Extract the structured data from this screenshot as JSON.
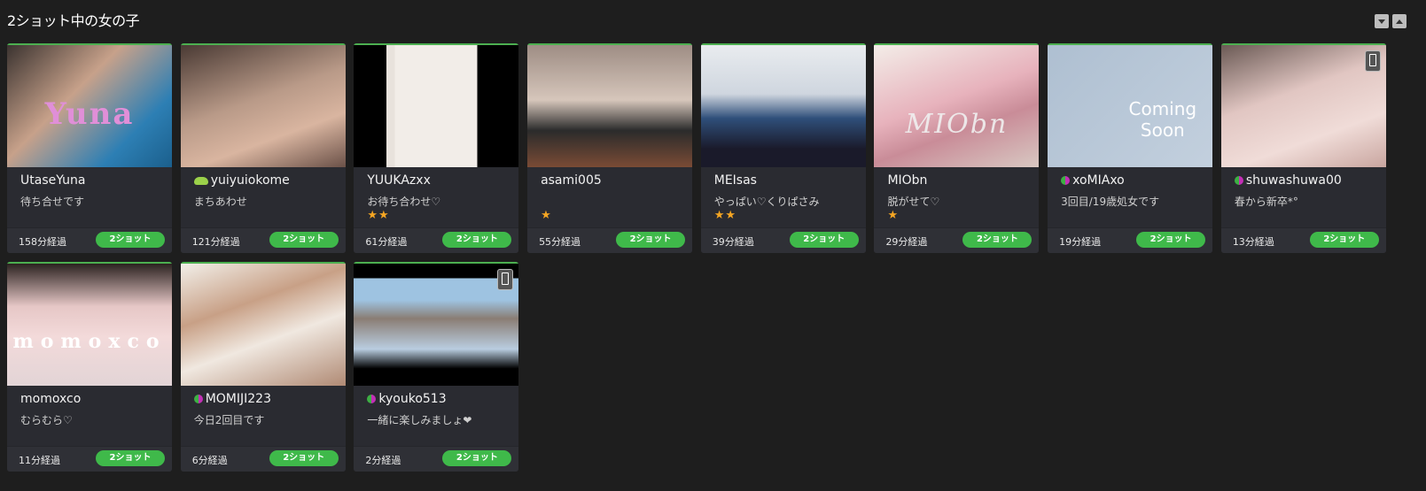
{
  "header": {
    "title": "2ショット中の女の子"
  },
  "cards": [
    {
      "name": "UtaseYuna",
      "message": "待ち合せです",
      "stars": "",
      "elapsed": "158分経過",
      "button": "2ショット",
      "badge": "none",
      "thumb_label": "Yuna",
      "thumb_style": "purple",
      "mobile": false,
      "bg": "linear-gradient(135deg,#3b3330,#c7a18a 40%,#2d7fb4 75%,#1b5f8c)"
    },
    {
      "name": "yuiyuiokome",
      "message": "まちあわせ",
      "stars": "",
      "elapsed": "121分経過",
      "button": "2ショット",
      "badge": "frog",
      "thumb_label": "",
      "thumb_style": "",
      "mobile": false,
      "bg": "linear-gradient(160deg,#4a3a34,#b99a88 45%,#d9b5a0 70%,#6b5148)"
    },
    {
      "name": "YUUKAzxx",
      "message": "お待ち合わせ♡",
      "stars": "★★",
      "elapsed": "61分経過",
      "button": "2ショット",
      "badge": "none",
      "thumb_label": "",
      "thumb_style": "",
      "mobile": false,
      "bg": "linear-gradient(90deg,#000 0 20%,#e8e2dc 20% 25%,#f2ede8 25% 75%,#000 75%)"
    },
    {
      "name": "asami005",
      "message": "",
      "stars": "★",
      "elapsed": "55分経過",
      "button": "2ショット",
      "badge": "none",
      "thumb_label": "",
      "thumb_style": "",
      "mobile": false,
      "bg": "linear-gradient(180deg,#9e8d84,#d6c6bb 45%,#2b2b2b 70%,#7a4b35)"
    },
    {
      "name": "MEIsas",
      "message": "やっぱい♡くりぱさみ",
      "stars": "★★",
      "elapsed": "39分経過",
      "button": "2ショット",
      "badge": "none",
      "thumb_label": "",
      "thumb_style": "",
      "mobile": false,
      "bg": "linear-gradient(180deg,#e9ecef,#cfd6df 40%,#2f4f7a 60%,#1a1a2a 85%)"
    },
    {
      "name": "MIObn",
      "message": "脱がせて♡",
      "stars": "★",
      "elapsed": "29分経過",
      "button": "2ショット",
      "badge": "none",
      "thumb_label": "MIObn",
      "thumb_style": "italic",
      "mobile": false,
      "bg": "linear-gradient(160deg,#f3ede8,#e7b2bc 45%,#c98c98 65%,#d8c8c2)"
    },
    {
      "name": "xoMIAxo",
      "message": "3回目/19歳処女です",
      "stars": "",
      "elapsed": "19分経過",
      "button": "2ショット",
      "badge": "leaf",
      "thumb_label": "",
      "thumb_style": "coming",
      "mobile": false,
      "bg": "linear-gradient(135deg,#aebfd1,#c3d0de)"
    },
    {
      "name": "shuwashuwa00",
      "message": "春から新卒*°",
      "stars": "",
      "elapsed": "13分経過",
      "button": "2ショット",
      "badge": "leaf",
      "thumb_label": "",
      "thumb_style": "",
      "mobile": true,
      "bg": "linear-gradient(160deg,#6b5a55,#e1c6c2 40%,#f0dcd8 70%,#c9a6a0)"
    },
    {
      "name": "momoxco",
      "message": "むらむら♡",
      "stars": "",
      "elapsed": "11分経過",
      "button": "2ショット",
      "badge": "none",
      "thumb_label": "momoxco",
      "thumb_style": "spaced",
      "mobile": false,
      "bg": "linear-gradient(180deg,#2b2220,#e6c7c6 35%,#f3dada 60%,#e2d4d6)"
    },
    {
      "name": "MOMIJI223",
      "message": "今日2回目です",
      "stars": "",
      "elapsed": "6分経過",
      "button": "2ショット",
      "badge": "leaf",
      "thumb_label": "",
      "thumb_style": "",
      "mobile": false,
      "bg": "linear-gradient(160deg,#f2efe9,#c8a086 35%,#f0e8e0 60%,#b08a74)"
    },
    {
      "name": "kyouko513",
      "message": "一緒に楽しみましょ❤",
      "stars": "",
      "elapsed": "2分経過",
      "button": "2ショット",
      "badge": "leaf",
      "thumb_label": "",
      "thumb_style": "video",
      "mobile": true,
      "bg": "linear-gradient(180deg,#000 0 12%,#9ec3e1 12% 30%,#8a7d74 45%,#b9cde0 70%,#000 86%)"
    }
  ],
  "coming_soon": {
    "line1": "Coming",
    "line2": "Soon"
  }
}
